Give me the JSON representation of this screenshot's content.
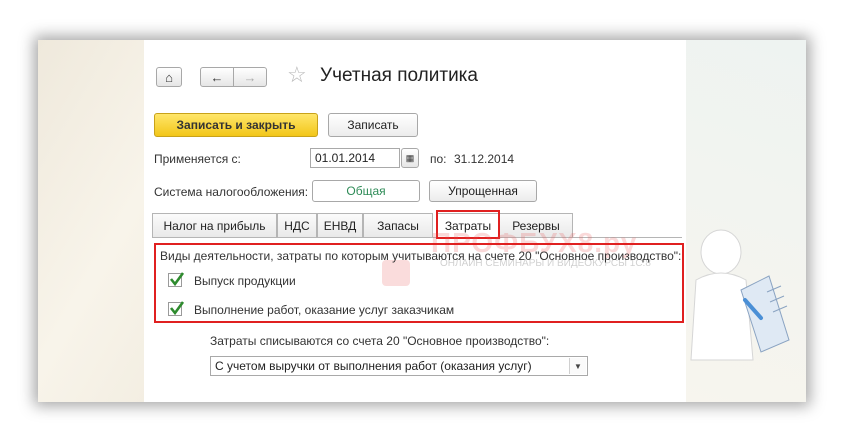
{
  "window": {
    "title": "Учетная политика"
  },
  "nav": {
    "home_icon": "home-icon",
    "back_icon": "arrow-left-icon",
    "forward_icon": "arrow-right-icon",
    "favorite_icon": "star-icon"
  },
  "toolbar": {
    "save_close_label": "Записать и закрыть",
    "save_label": "Записать"
  },
  "period": {
    "applies_label": "Применяется с:",
    "from_value": "01.01.2014",
    "to_label": "по:",
    "to_value": "31.12.2014"
  },
  "tax": {
    "label": "Система налогообложения:",
    "options": [
      "Общая",
      "Упрощенная"
    ],
    "selected": "Общая"
  },
  "tabs": [
    {
      "label": "Налог на прибыль"
    },
    {
      "label": "НДС"
    },
    {
      "label": "ЕНВД"
    },
    {
      "label": "Запасы"
    },
    {
      "label": "Затраты"
    },
    {
      "label": "Резервы"
    }
  ],
  "active_tab": "Затраты",
  "costs": {
    "activities_header": "Виды деятельности, затраты по которым учитываются на счете 20 \"Основное производство\":",
    "options": [
      {
        "label": "Выпуск продукции",
        "checked": true
      },
      {
        "label": "Выполнение работ, оказание услуг заказчикам",
        "checked": true
      }
    ],
    "writeoff_label": "Затраты списываются со счета 20 \"Основное производство\":",
    "writeoff_value": "С учетом выручки от выполнения работ (оказания услуг)"
  },
  "watermark": {
    "brand": "ПРОФБУХ8.ру",
    "tagline": "ОНЛАЙН СЕМИНАРЫ И ВИДЕОКУРСЫ 1С:8"
  },
  "colors": {
    "accent": "#f2c619",
    "highlight": "#e02020",
    "check": "#2e8b2e",
    "selected_option": "#2e8b57"
  }
}
